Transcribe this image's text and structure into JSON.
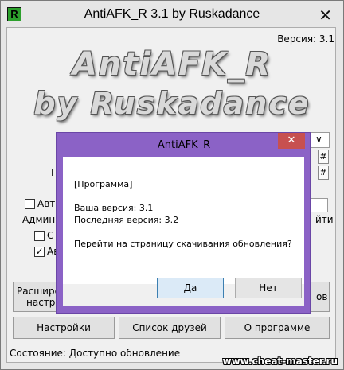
{
  "window": {
    "icon_letter": "R",
    "title": "AntiAFK_R 3.1 by Ruskadance",
    "close_glyph": "✕"
  },
  "version_label": "Версия: 3.1",
  "logo": {
    "line1": "AntiAFK_R",
    "line2": "by Ruskadance"
  },
  "background_fragments": {
    "p_label": "П",
    "auto_label": "Авто",
    "admin_label": "Админ р",
    "sub_c": "С",
    "sub_a": "Ав",
    "ti_label": "йти",
    "hash1": "#",
    "hash2": "#",
    "dropdown_arrow": "∨",
    "ext_line1": "Расшире",
    "ext_line2": "настро",
    "right_v": "ов",
    "checkmark": "✓"
  },
  "bottom_buttons": {
    "settings": "Настройки",
    "friends": "Список друзей",
    "about": "О программе"
  },
  "status": "Состояние: Доступно обновление",
  "watermark": "www.cheat-master.ru",
  "dialog": {
    "title": "AntiAFK_R",
    "close_glyph": "✕",
    "line1": "[Программа]",
    "line2": "Ваша версия: 3.1",
    "line3": "Последняя версия: 3.2",
    "line4": "Перейти на страницу скачивания обновления?",
    "yes": "Да",
    "no": "Нет"
  }
}
